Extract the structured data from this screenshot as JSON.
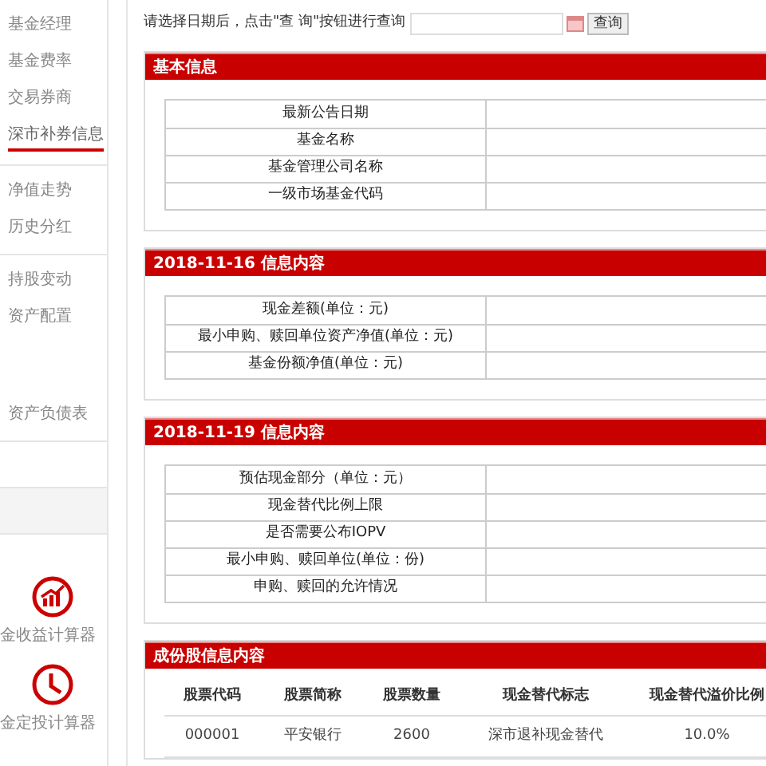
{
  "sidebar": {
    "groups": [
      {
        "items": [
          {
            "label": "基金经理",
            "selected": false
          },
          {
            "label": "基金费率",
            "selected": false
          },
          {
            "label": "交易券商",
            "selected": false
          },
          {
            "label": "深市补券信息",
            "selected": true
          }
        ]
      },
      {
        "items": [
          {
            "label": "净值走势",
            "selected": false
          },
          {
            "label": "历史分红",
            "selected": false
          }
        ]
      },
      {
        "items": [
          {
            "label": "持股变动",
            "selected": false
          },
          {
            "label": "资产配置",
            "selected": false
          },
          {
            "label": "资产负债表",
            "selected": false
          }
        ]
      }
    ],
    "tools": [
      {
        "kind": "chart",
        "label": "金收益计算器"
      },
      {
        "kind": "clock",
        "label": "金定投计算器"
      }
    ]
  },
  "query": {
    "prompt": "请选择日期后，点击\"查 询\"按钮进行查询",
    "button": "查询"
  },
  "sections": [
    {
      "title": "基本信息",
      "rows": [
        "最新公告日期",
        "基金名称",
        "基金管理公司名称",
        "一级市场基金代码"
      ]
    },
    {
      "title": "2018-11-16 信息内容",
      "rows": [
        "现金差额(单位：元)",
        "最小申购、赎回单位资产净值(单位：元)",
        "基金份额净值(单位：元)"
      ]
    },
    {
      "title": "2018-11-19 信息内容",
      "rows": [
        "预估现金部分（单位：元）",
        "现金替代比例上限",
        "是否需要公布IOPV",
        "最小申购、赎回单位(单位：份)",
        "申购、赎回的允许情况"
      ]
    }
  ],
  "holdings": {
    "title": "成份股信息内容",
    "columns": [
      "股票代码",
      "股票简称",
      "股票数量",
      "现金替代标志",
      "现金替代溢价比例"
    ],
    "rows": [
      [
        "000001",
        "平安银行",
        "2600",
        "深市退补现金替代",
        "10.0%"
      ]
    ]
  }
}
